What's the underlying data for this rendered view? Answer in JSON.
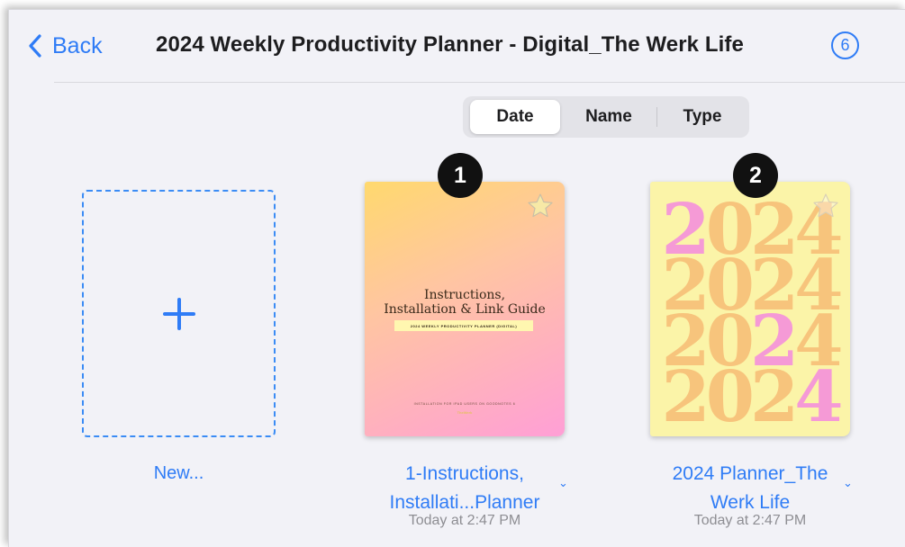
{
  "header": {
    "back_label": "Back",
    "title": "2024 Weekly Productivity Planner - Digital_The Werk Life",
    "count_badge": "6"
  },
  "sort": {
    "options": [
      "Date",
      "Name",
      "Type"
    ],
    "selected": "Date"
  },
  "new_item": {
    "label": "New..."
  },
  "files": [
    {
      "marker": "1",
      "name_line1": "1-Instructions,",
      "name_line2": "Installati...Planner",
      "date": "Today at 2:47 PM",
      "cover": {
        "title_line1": "Instructions,",
        "title_line2": "Installation & Link Guide",
        "subtitle": "2024 WEEKLY PRODUCTIVITY PLANNER (DIGITAL)",
        "footer": "INSTALLATION FOR IPAD USERS ON GOODNOTES 6",
        "footer_brand": "TheWerk"
      }
    },
    {
      "marker": "2",
      "name_line1": "2024 Planner_The",
      "name_line2": "Werk Life",
      "date": "Today at 2:47 PM",
      "cover": {
        "years": [
          "2024",
          "2024",
          "2024",
          "2024"
        ]
      }
    }
  ],
  "colors": {
    "accent": "#2f7cf6",
    "background": "#f2f2f7",
    "cover1_gradient": [
      "#ffd96e",
      "#ff9fd6"
    ],
    "cover2_bg": "#fbf4a8",
    "cover2_orange": "#f7c47c",
    "cover2_pink": "#f59ad6"
  }
}
